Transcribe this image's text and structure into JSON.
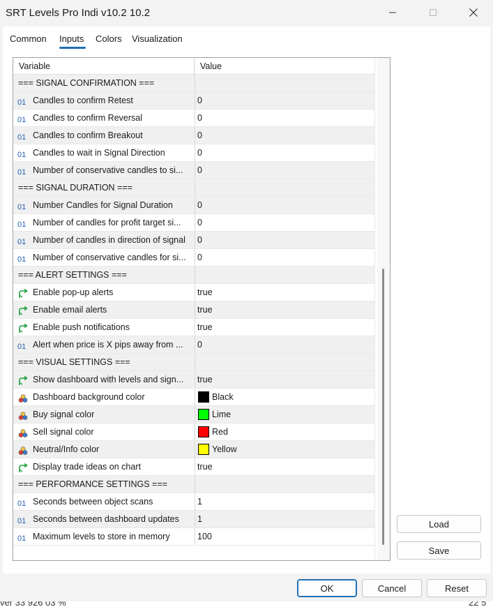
{
  "window": {
    "title": "SRT Levels Pro Indi v10.2 10.2"
  },
  "tabs": [
    {
      "label": "Common"
    },
    {
      "label": "Inputs"
    },
    {
      "label": "Colors"
    },
    {
      "label": "Visualization"
    }
  ],
  "active_tab": "Inputs",
  "grid": {
    "header_variable": "Variable",
    "header_value": "Value",
    "rows": [
      {
        "kind": "section",
        "label": "=== SIGNAL CONFIRMATION ==="
      },
      {
        "kind": "int",
        "icon": "integer-icon",
        "label": "Candles to confirm Retest",
        "value": "0"
      },
      {
        "kind": "int",
        "icon": "integer-icon",
        "label": "Candles to confirm Reversal",
        "value": "0"
      },
      {
        "kind": "int",
        "icon": "integer-icon",
        "label": "Candles to confirm Breakout",
        "value": "0"
      },
      {
        "kind": "int",
        "icon": "integer-icon",
        "label": "Candles to wait in Signal Direction",
        "value": "0"
      },
      {
        "kind": "int",
        "icon": "integer-icon",
        "label": "Number of conservative candles to si...",
        "value": "0"
      },
      {
        "kind": "section",
        "label": "=== SIGNAL DURATION ==="
      },
      {
        "kind": "int",
        "icon": "integer-icon",
        "label": "Number Candles for Signal Duration",
        "value": "0"
      },
      {
        "kind": "int",
        "icon": "integer-icon",
        "label": "Number of candles for profit target si...",
        "value": "0"
      },
      {
        "kind": "int",
        "icon": "integer-icon",
        "label": "Number of candles in direction of signal",
        "value": "0"
      },
      {
        "kind": "int",
        "icon": "integer-icon",
        "label": "Number of conservative candles for si...",
        "value": "0"
      },
      {
        "kind": "section",
        "label": "=== ALERT SETTINGS ==="
      },
      {
        "kind": "bool",
        "icon": "boolean-arrow-icon",
        "label": "Enable pop-up alerts",
        "value": "true"
      },
      {
        "kind": "bool",
        "icon": "boolean-arrow-icon",
        "label": "Enable email alerts",
        "value": "true"
      },
      {
        "kind": "bool",
        "icon": "boolean-arrow-icon",
        "label": "Enable push notifications",
        "value": "true"
      },
      {
        "kind": "int",
        "icon": "integer-icon",
        "label": "Alert when price is X pips away from ...",
        "value": "0"
      },
      {
        "kind": "section",
        "label": "=== VISUAL SETTINGS ==="
      },
      {
        "kind": "bool",
        "icon": "boolean-arrow-icon",
        "label": "Show dashboard with levels and sign...",
        "value": "true"
      },
      {
        "kind": "color",
        "icon": "color-circles-icon",
        "label": "Dashboard background color",
        "value": "Black",
        "swatch": "#000000"
      },
      {
        "kind": "color",
        "icon": "color-circles-icon",
        "label": "Buy signal color",
        "value": "Lime",
        "swatch": "#00ff00"
      },
      {
        "kind": "color",
        "icon": "color-circles-icon",
        "label": "Sell signal color",
        "value": "Red",
        "swatch": "#ff0000"
      },
      {
        "kind": "color",
        "icon": "color-circles-icon",
        "label": "Neutral/Info color",
        "value": "Yellow",
        "swatch": "#ffff00"
      },
      {
        "kind": "bool",
        "icon": "boolean-arrow-icon",
        "label": "Display trade ideas on chart",
        "value": "true"
      },
      {
        "kind": "section",
        "label": "=== PERFORMANCE SETTINGS ==="
      },
      {
        "kind": "int",
        "icon": "integer-icon",
        "label": "Seconds between object scans",
        "value": "1"
      },
      {
        "kind": "int",
        "icon": "integer-icon",
        "label": "Seconds between dashboard updates",
        "value": "1"
      },
      {
        "kind": "int",
        "icon": "integer-icon",
        "label": "Maximum levels to store in memory",
        "value": "100"
      }
    ]
  },
  "side_buttons": {
    "load": "Load",
    "save": "Save"
  },
  "footer": {
    "ok": "OK",
    "cancel": "Cancel",
    "reset": "Reset"
  },
  "background_text": {
    "left": "ver 33 926 03 %",
    "right": "22 5"
  },
  "colors": {
    "accent": "#1f6fb5",
    "integer_icon": "#1f5fae",
    "boolean_icon": "#1e9e3e"
  }
}
